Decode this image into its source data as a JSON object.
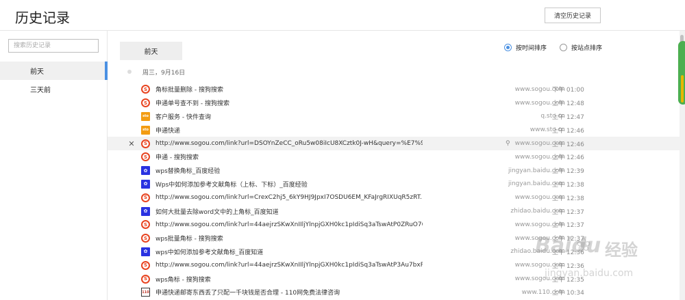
{
  "header": {
    "title": "历史记录",
    "clear_label": "清空历史记录"
  },
  "sidebar": {
    "search_placeholder": "搜索历史记录",
    "items": [
      {
        "label": "前天",
        "active": true
      },
      {
        "label": "三天前",
        "active": false
      }
    ]
  },
  "main": {
    "day_tab": "前天",
    "sort_options": [
      {
        "label": "按时间排序",
        "selected": true
      },
      {
        "label": "按站点排序",
        "selected": false
      }
    ],
    "date_heading": "周三，9月16日",
    "rows": [
      {
        "icon": "sogou-icon",
        "title": "角标批量删除 - 搜狗搜索",
        "domain": "www.sogou.com",
        "time": "下午 01:00"
      },
      {
        "icon": "sogou-icon",
        "title": "申通单号查不到 - 搜狗搜索",
        "domain": "www.sogou.com",
        "time": "上午 12:48"
      },
      {
        "icon": "sto-icon",
        "title": "客户服务 - 快件查询",
        "domain": "q.sto.cn",
        "time": "上午 12:47"
      },
      {
        "icon": "sto-icon",
        "title": "申通快递",
        "domain": "www.sto.cn",
        "time": "上午 12:46"
      },
      {
        "icon": "sogou-icon",
        "title": "http://www.sogou.com/link?url=DSOYnZeCC_oRu5w08iIcU8XCztk0J-wH&query=%E7%9...",
        "domain": "www.sogou.com",
        "time": "上午 12:46",
        "hover": true
      },
      {
        "icon": "sogou-icon",
        "title": "申通 - 搜狗搜索",
        "domain": "www.sogou.com",
        "time": "上午 12:46"
      },
      {
        "icon": "baidu-icon",
        "title": "wps替换角标_百度经验",
        "domain": "jingyan.baidu.com",
        "time": "上午 12:39"
      },
      {
        "icon": "baidu-icon",
        "title": "Wps中如何添加参考文献角标（上标、下标）_百度经验",
        "domain": "jingyan.baidu.com",
        "time": "上午 12:38"
      },
      {
        "icon": "sogou-icon",
        "title": "http://www.sogou.com/link?url=CrexC2hj5_6kY9HJ9JpxI7OSDU6EM_KFaJrgRIXUqR5zRT...",
        "domain": "www.sogou.com",
        "time": "上午 12:38"
      },
      {
        "icon": "baidu-icon",
        "title": "如何大批量去除word文中的上角标_百度知道",
        "domain": "zhidao.baidu.com",
        "time": "上午 12:37"
      },
      {
        "icon": "sogou-icon",
        "title": "http://www.sogou.com/link?url=44aejrzSKwXnIIljYlnpjGXH0kc1pIdiSq3aTswAtP0ZRuO76...",
        "domain": "www.sogou.com",
        "time": "上午 12:37"
      },
      {
        "icon": "sogou-icon",
        "title": "wps批量角标 - 搜狗搜索",
        "domain": "www.sogou.com",
        "time": "上午 12:37"
      },
      {
        "icon": "baidu-icon",
        "title": "wps中如何添加参考文献角标_百度知道",
        "domain": "zhidao.baidu.com",
        "time": "上午 12:36"
      },
      {
        "icon": "sogou-icon",
        "title": "http://www.sogou.com/link?url=44aejrzSKwXnIIljYlnpjGXH0kc1pIdiSq3aTswAtP3Au7bxR...",
        "domain": "www.sogou.com",
        "time": "上午 12:36"
      },
      {
        "icon": "sogou-icon",
        "title": "wps角标 - 搜狗搜索",
        "domain": "www.sogou.com",
        "time": "上午 12:35"
      },
      {
        "icon": "110-icon",
        "title": "申通快递邮寄东西丢了只配一千块钱是否合理 - 110网免费法律咨询",
        "domain": "www.110.com",
        "time": "上午 10:34"
      }
    ]
  },
  "watermark": {
    "brand": "Baidu",
    "suffix": "经验",
    "url": "jingyan.baidu.com"
  },
  "colors": {
    "accent": "#4a90e2",
    "sogou": "#e8431f",
    "baidu": "#2932e1",
    "sto": "#f39c12"
  }
}
